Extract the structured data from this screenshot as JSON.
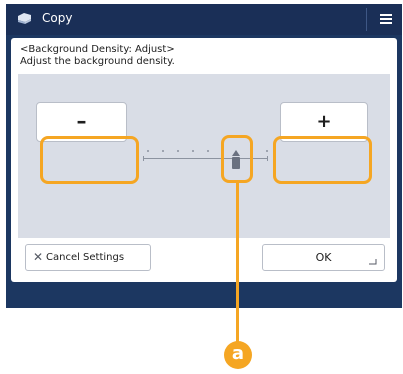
{
  "window": {
    "title": "Copy",
    "app_icon": "copy-app-icon",
    "menu_icon": "menu-icon"
  },
  "dialog": {
    "heading": "<Background Density: Adjust>",
    "instruction": "Adjust the background density.",
    "minus_label": "–",
    "plus_label": "+",
    "cancel_icon": "close-icon",
    "cancel_label": "Cancel Settings",
    "ok_label": "OK"
  },
  "slider": {
    "steps": 9,
    "position": 6
  },
  "callout": {
    "label": "a"
  },
  "colors": {
    "title_bar": "#1a2f57",
    "screen_background": "#1c3761",
    "panel": "#d9dde6",
    "highlight": "#f5a623"
  }
}
